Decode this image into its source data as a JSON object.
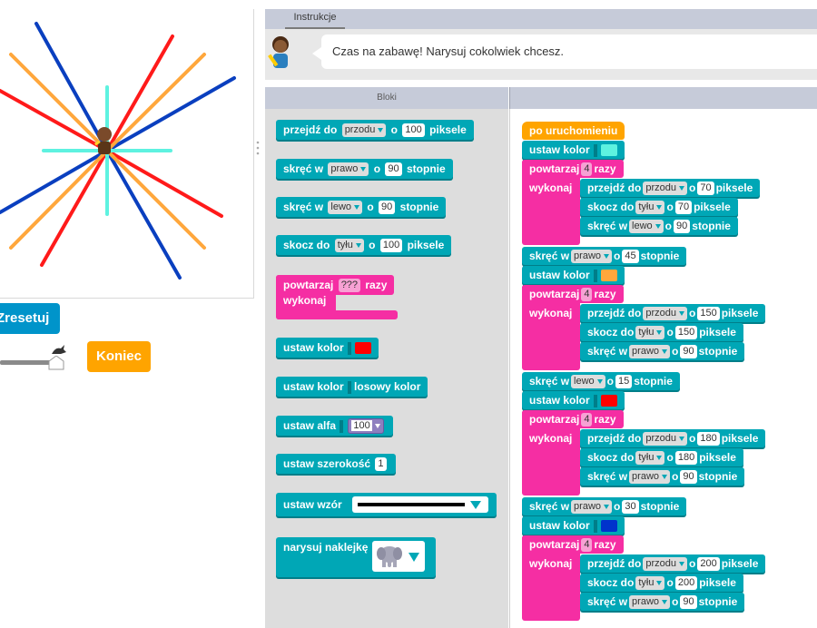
{
  "instructions": {
    "tab_label": "Instrukcje",
    "message": "Czas na zabawę! Narysuj cokolwiek chcesz."
  },
  "controls": {
    "reset_label": "Zresetuj",
    "finish_label": "Koniec"
  },
  "toolbox": {
    "header": "Bloki",
    "move": {
      "label_a": "przejdź do",
      "dir": "przodu",
      "label_b": "o",
      "value": "100",
      "label_c": "piksele"
    },
    "turn_right": {
      "label_a": "skręć w",
      "dir": "prawo",
      "label_b": "o",
      "value": "90",
      "label_c": "stopnie"
    },
    "turn_left": {
      "label_a": "skręć w",
      "dir": "lewo",
      "label_b": "o",
      "value": "90",
      "label_c": "stopnie"
    },
    "jump": {
      "label_a": "skocz do",
      "dir": "tyłu",
      "label_b": "o",
      "value": "100",
      "label_c": "piksele"
    },
    "repeat": {
      "label_a": "powtarzaj",
      "value": "???",
      "label_b": "razy",
      "do_label": "wykonaj"
    },
    "set_color": {
      "label": "ustaw kolor",
      "color": "#ff0000"
    },
    "set_random_color": {
      "label": "ustaw kolor",
      "value": "losowy kolor"
    },
    "set_alpha": {
      "label": "ustaw alfa",
      "value": "100"
    },
    "set_width": {
      "label": "ustaw szerokość",
      "value": "1"
    },
    "set_pattern": {
      "label": "ustaw wzór"
    },
    "draw_sticker": {
      "label": "narysuj naklejkę",
      "sticker_icon": "elephant-icon"
    }
  },
  "program": {
    "when_run": "po uruchomieniu",
    "steps": [
      {
        "type": "color",
        "label": "ustaw kolor",
        "color": "#5ef2e0"
      },
      {
        "type": "repeat",
        "label_a": "powtarzaj",
        "times": "4",
        "label_b": "razy",
        "do_label": "wykonaj",
        "inner": [
          {
            "label_a": "przejdź do",
            "dir": "przodu",
            "label_b": "o",
            "value": "70",
            "label_c": "piksele"
          },
          {
            "label_a": "skocz do",
            "dir": "tyłu",
            "label_b": "o",
            "value": "70",
            "label_c": "piksele"
          },
          {
            "label_a": "skręć w",
            "dir": "lewo",
            "label_b": "o",
            "value": "90",
            "label_c": "stopnie"
          }
        ]
      },
      {
        "type": "turn",
        "label_a": "skręć w",
        "dir": "prawo",
        "label_b": "o",
        "value": "45",
        "label_c": "stopnie"
      },
      {
        "type": "color",
        "label": "ustaw kolor",
        "color": "#ffa73c"
      },
      {
        "type": "repeat",
        "label_a": "powtarzaj",
        "times": "4",
        "label_b": "razy",
        "do_label": "wykonaj",
        "inner": [
          {
            "label_a": "przejdź do",
            "dir": "przodu",
            "label_b": "o",
            "value": "150",
            "label_c": "piksele"
          },
          {
            "label_a": "skocz do",
            "dir": "tyłu",
            "label_b": "o",
            "value": "150",
            "label_c": "piksele"
          },
          {
            "label_a": "skręć w",
            "dir": "prawo",
            "label_b": "o",
            "value": "90",
            "label_c": "stopnie"
          }
        ]
      },
      {
        "type": "turn",
        "label_a": "skręć w",
        "dir": "lewo",
        "label_b": "o",
        "value": "15",
        "label_c": "stopnie"
      },
      {
        "type": "color",
        "label": "ustaw kolor",
        "color": "#ff0000"
      },
      {
        "type": "repeat",
        "label_a": "powtarzaj",
        "times": "4",
        "label_b": "razy",
        "do_label": "wykonaj",
        "inner": [
          {
            "label_a": "przejdź do",
            "dir": "przodu",
            "label_b": "o",
            "value": "180",
            "label_c": "piksele"
          },
          {
            "label_a": "skocz do",
            "dir": "tyłu",
            "label_b": "o",
            "value": "180",
            "label_c": "piksele"
          },
          {
            "label_a": "skręć w",
            "dir": "prawo",
            "label_b": "o",
            "value": "90",
            "label_c": "stopnie"
          }
        ]
      },
      {
        "type": "turn",
        "label_a": "skręć w",
        "dir": "prawo",
        "label_b": "o",
        "value": "30",
        "label_c": "stopnie"
      },
      {
        "type": "color",
        "label": "ustaw kolor",
        "color": "#0033cc"
      },
      {
        "type": "repeat",
        "label_a": "powtarzaj",
        "times": "4",
        "label_b": "razy",
        "do_label": "wykonaj",
        "inner": [
          {
            "label_a": "przejdź do",
            "dir": "przodu",
            "label_b": "o",
            "value": "200",
            "label_c": "piksele"
          },
          {
            "label_a": "skocz do",
            "dir": "tyłu",
            "label_b": "o",
            "value": "200",
            "label_c": "piksele"
          },
          {
            "label_a": "skręć w",
            "dir": "prawo",
            "label_b": "o",
            "value": "90",
            "label_c": "stopnie"
          }
        ]
      }
    ]
  },
  "drawing": {
    "colors": {
      "cyan": "#5ef2e0",
      "orange": "#ffa73c",
      "red": "#ff1a1a",
      "blue": "#0a3fbf"
    }
  }
}
